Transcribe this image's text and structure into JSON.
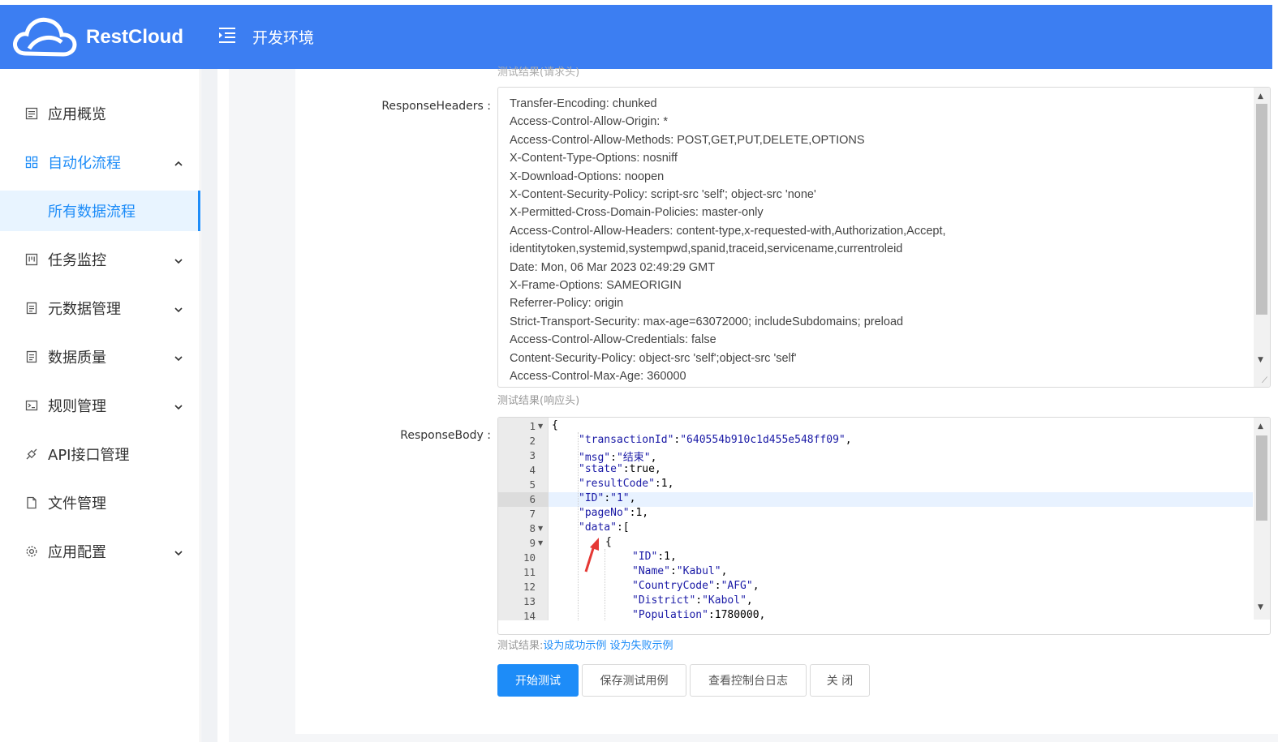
{
  "header": {
    "logo_text": "RestCloud",
    "env_title": "开发环境",
    "bg_color": "#3c7ef2"
  },
  "sidebar": {
    "items": [
      {
        "label": "应用概览",
        "icon": "list-icon",
        "state": "normal"
      },
      {
        "label": "自动化流程",
        "icon": "grid-icon",
        "state": "expanded",
        "chevron": "up"
      },
      {
        "label": "所有数据流程",
        "icon": "",
        "state": "selected"
      },
      {
        "label": "任务监控",
        "icon": "monitor-icon",
        "state": "normal",
        "chevron": "down"
      },
      {
        "label": "元数据管理",
        "icon": "document-icon",
        "state": "normal",
        "chevron": "down"
      },
      {
        "label": "数据质量",
        "icon": "document-icon",
        "state": "normal",
        "chevron": "down"
      },
      {
        "label": "规则管理",
        "icon": "terminal-icon",
        "state": "normal",
        "chevron": "down"
      },
      {
        "label": "API接口管理",
        "icon": "plug-icon",
        "state": "normal"
      },
      {
        "label": "文件管理",
        "icon": "file-icon",
        "state": "normal"
      },
      {
        "label": "应用配置",
        "icon": "gear-icon",
        "state": "normal",
        "chevron": "down"
      }
    ],
    "accent_color": "#1d8cf8"
  },
  "form": {
    "cut_hint": "测试结果(请求头)",
    "response_headers_label": "ResponseHeaders :",
    "response_headers_lines": [
      "Transfer-Encoding: chunked",
      "Access-Control-Allow-Origin: *",
      "Access-Control-Allow-Methods: POST,GET,PUT,DELETE,OPTIONS",
      "X-Content-Type-Options: nosniff",
      "X-Download-Options: noopen",
      "X-Content-Security-Policy: script-src 'self'; object-src 'none'",
      "X-Permitted-Cross-Domain-Policies: master-only",
      "Access-Control-Allow-Headers: content-type,x-requested-with,Authorization,Accept,",
      "identitytoken,systemid,systempwd,spanid,traceid,servicename,currentroleid",
      "Date: Mon, 06 Mar 2023 02:49:29 GMT",
      "X-Frame-Options: SAMEORIGIN",
      "Referrer-Policy: origin",
      "Strict-Transport-Security: max-age=63072000; includeSubdomains; preload",
      "Access-Control-Allow-Credentials: false",
      "Content-Security-Policy: object-src 'self';object-src 'self'",
      "Access-Control-Max-Age: 360000"
    ],
    "headers_hint": "测试结果(响应头)",
    "response_body_label": "ResponseBody :",
    "body_lines": [
      {
        "n": "1",
        "fold": true,
        "indent": 0,
        "text": "{"
      },
      {
        "n": "2",
        "indent": 1,
        "key": "\"transactionId\"",
        "val": ":\"640554b910c1d455e548ff09\","
      },
      {
        "n": "3",
        "indent": 1,
        "key": "\"msg\"",
        "val": ":\"结束\","
      },
      {
        "n": "4",
        "indent": 1,
        "key": "\"state\"",
        "val": ":true,"
      },
      {
        "n": "5",
        "indent": 1,
        "key": "\"resultCode\"",
        "val": ":1,"
      },
      {
        "n": "6",
        "indent": 1,
        "key": "\"ID\"",
        "val": ":\"1\",",
        "highlight": true
      },
      {
        "n": "7",
        "indent": 1,
        "key": "\"pageNo\"",
        "val": ":1,"
      },
      {
        "n": "8",
        "fold": true,
        "indent": 1,
        "key": "\"data\"",
        "val": ":["
      },
      {
        "n": "9",
        "fold": true,
        "indent": 2,
        "text": "{"
      },
      {
        "n": "10",
        "indent": 3,
        "key": "\"ID\"",
        "val": ":1,"
      },
      {
        "n": "11",
        "indent": 3,
        "key": "\"Name\"",
        "val": ":\"Kabul\","
      },
      {
        "n": "12",
        "indent": 3,
        "key": "\"CountryCode\"",
        "val": ":\"AFG\","
      },
      {
        "n": "13",
        "indent": 3,
        "key": "\"District\"",
        "val": ":\"Kabol\","
      },
      {
        "n": "14",
        "indent": 3,
        "key": "\"Population\"",
        "val": ":1780000,"
      }
    ],
    "result_prefix": "测试结果:",
    "set_success_link": "设为成功示例",
    "set_fail_link": "设为失败示例"
  },
  "buttons": {
    "start_test": "开始测试",
    "save_case": "保存测试用例",
    "view_log": "查看控制台日志",
    "close": "关 闭"
  }
}
